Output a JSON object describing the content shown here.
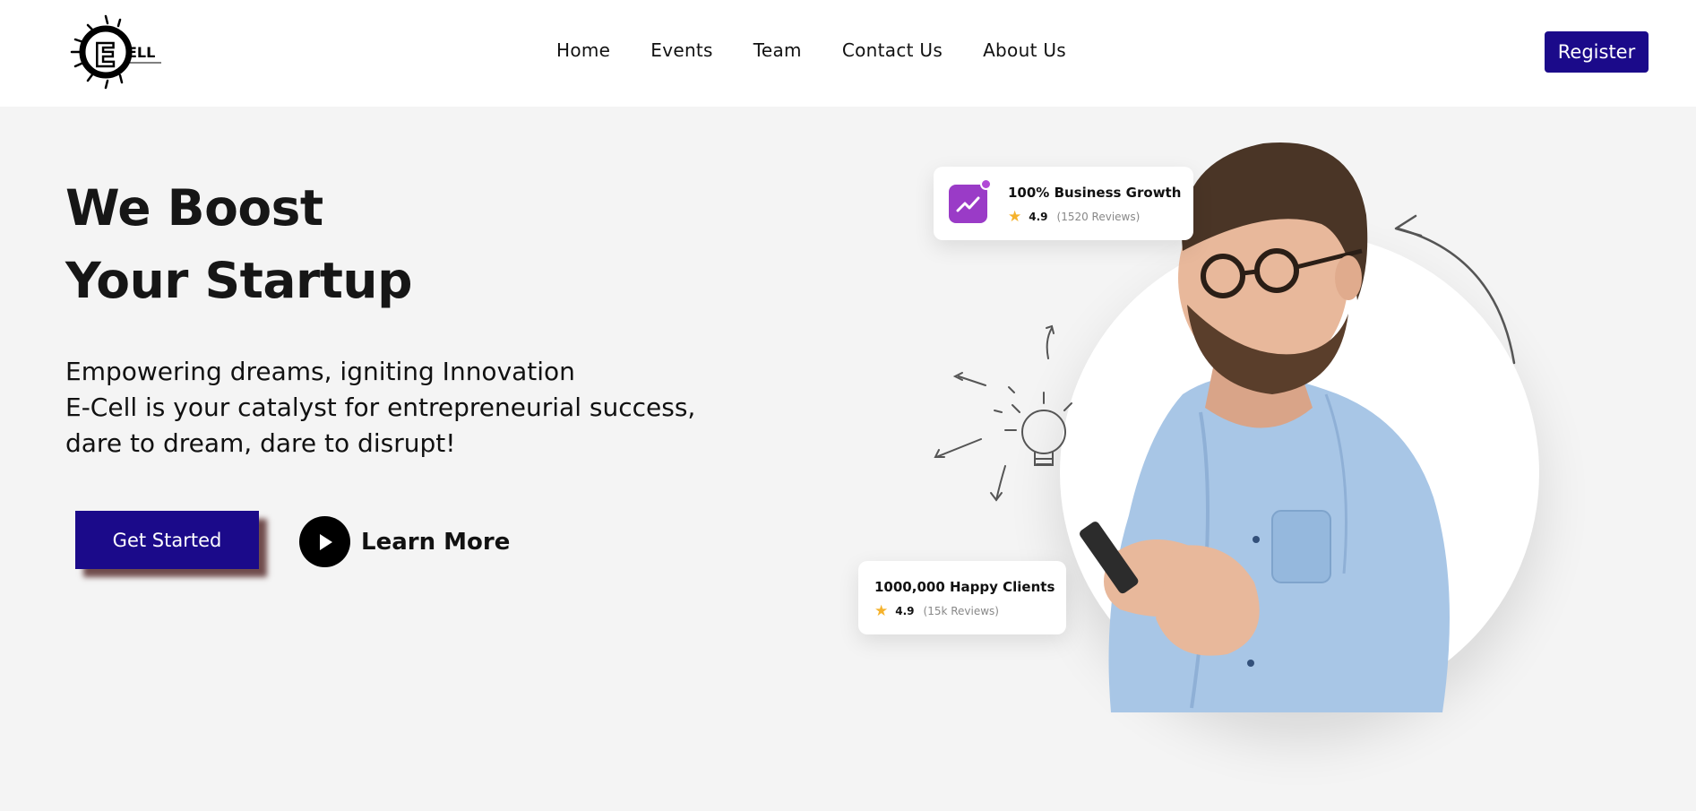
{
  "header": {
    "logo_text": "E CELL",
    "nav": [
      "Home",
      "Events",
      "Team",
      "Contact Us",
      "About Us"
    ],
    "register_label": "Register"
  },
  "hero": {
    "title_line1": "We Boost",
    "title_line2": "Your Startup",
    "subtitle_line1": "Empowering dreams, igniting Innovation",
    "subtitle_line2": "E-Cell is your catalyst for entrepreneurial success,",
    "subtitle_line3": "dare to dream, dare to disrupt!",
    "get_started_label": "Get Started",
    "learn_more_label": "Learn More"
  },
  "cards": {
    "growth": {
      "title": "100% Business Growth",
      "rating": "4.9",
      "reviews": "(1520 Reviews)"
    },
    "clients": {
      "title": "1000,000 Happy Clients",
      "rating": "4.9",
      "reviews": "(15k Reviews)"
    }
  },
  "colors": {
    "accent": "#1b0a8a",
    "growth_icon": "#9a3bc7",
    "star": "#f5b22c"
  }
}
